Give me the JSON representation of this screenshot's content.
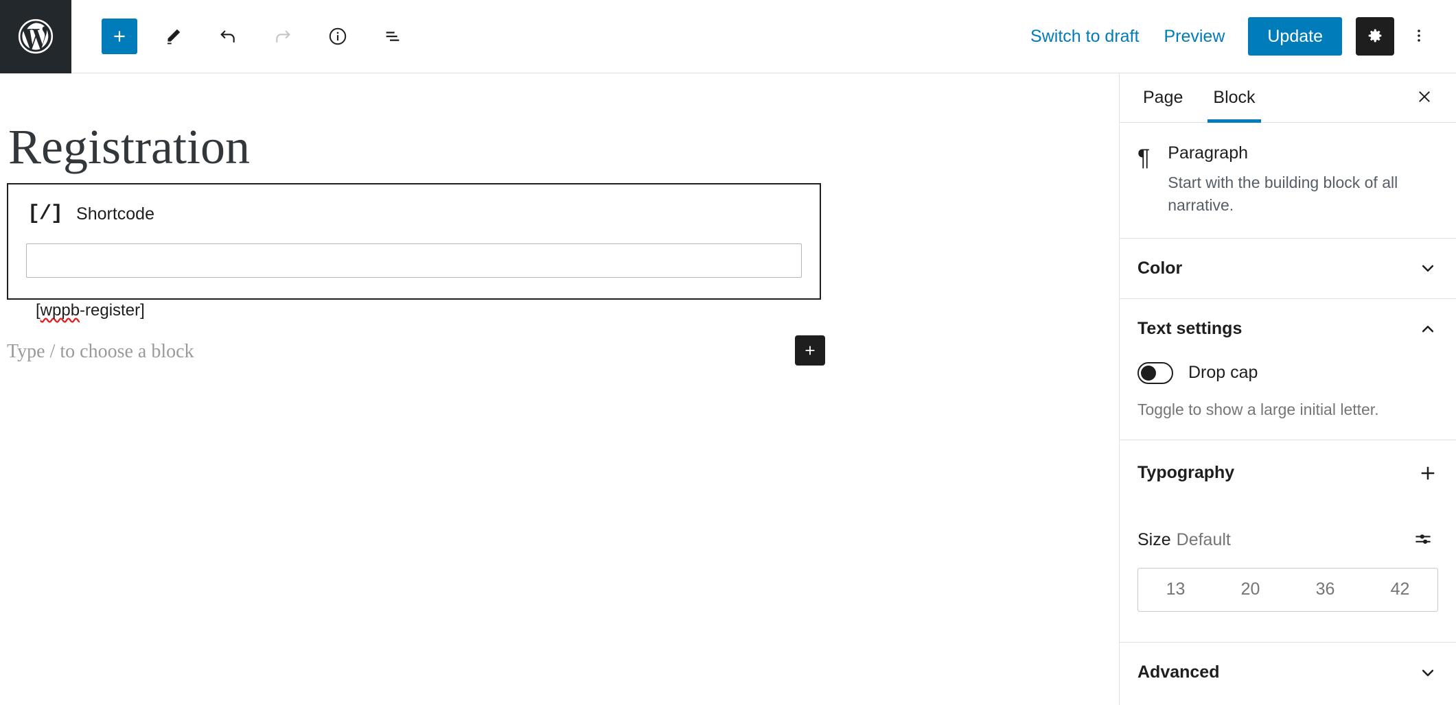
{
  "topbar": {
    "logo_icon": "wordpress-logo-icon",
    "tools": [
      {
        "name": "add-block-button",
        "icon": "plus-icon",
        "label": "Toggle block inserter",
        "state": "primary"
      },
      {
        "name": "tools-button",
        "icon": "pencil-icon",
        "label": "Tools",
        "state": "normal"
      },
      {
        "name": "undo-button",
        "icon": "undo-arrow-icon",
        "label": "Undo",
        "state": "enabled"
      },
      {
        "name": "redo-button",
        "icon": "redo-arrow-icon",
        "label": "Redo",
        "state": "disabled"
      },
      {
        "name": "details-button",
        "icon": "info-circle-icon",
        "label": "Details",
        "state": "normal"
      },
      {
        "name": "list-view-button",
        "icon": "list-view-icon",
        "label": "List view",
        "state": "normal"
      }
    ],
    "switch_to_draft": "Switch to draft",
    "preview": "Preview",
    "update": "Update",
    "settings_icon": "gear-icon",
    "more_icon": "kebab-menu-icon"
  },
  "editor": {
    "post_title": "Registration",
    "shortcode_block": {
      "glyph": "[/]",
      "label": "Shortcode",
      "value": "[wppb-register]",
      "misspelled_part": "wppb",
      "rest_part": "-register]",
      "open_bracket": "["
    },
    "appender_placeholder": "Type / to choose a block",
    "add_block_icon": "plus-icon"
  },
  "sidebar": {
    "tabs": [
      {
        "label": "Page",
        "active": false
      },
      {
        "label": "Block",
        "active": true
      }
    ],
    "close_icon": "close-icon",
    "block_card": {
      "icon": "pilcrow-icon",
      "glyph": "¶",
      "title": "Paragraph",
      "description": "Start with the building block of all narrative."
    },
    "panels": {
      "color": {
        "title": "Color",
        "icon": "chevron-down-icon",
        "expanded": false
      },
      "text_settings": {
        "title": "Text settings",
        "icon": "chevron-up-icon",
        "expanded": true,
        "drop_cap_label": "Drop cap",
        "drop_cap_on": false,
        "drop_cap_help": "Toggle to show a large initial letter."
      },
      "typography": {
        "title": "Typography",
        "icon": "plus-icon",
        "size_label": "Size",
        "size_value": "Default",
        "size_settings_icon": "sliders-icon",
        "presets": [
          "13",
          "20",
          "36",
          "42"
        ]
      },
      "advanced": {
        "title": "Advanced",
        "icon": "chevron-down-icon",
        "expanded": false
      }
    }
  },
  "colors": {
    "accent": "#007cba",
    "dark": "#1e1e1e",
    "logo_bg": "#23282d",
    "border": "#e0e0e0",
    "muted": "#757575",
    "spellcheck": "#e02020"
  }
}
